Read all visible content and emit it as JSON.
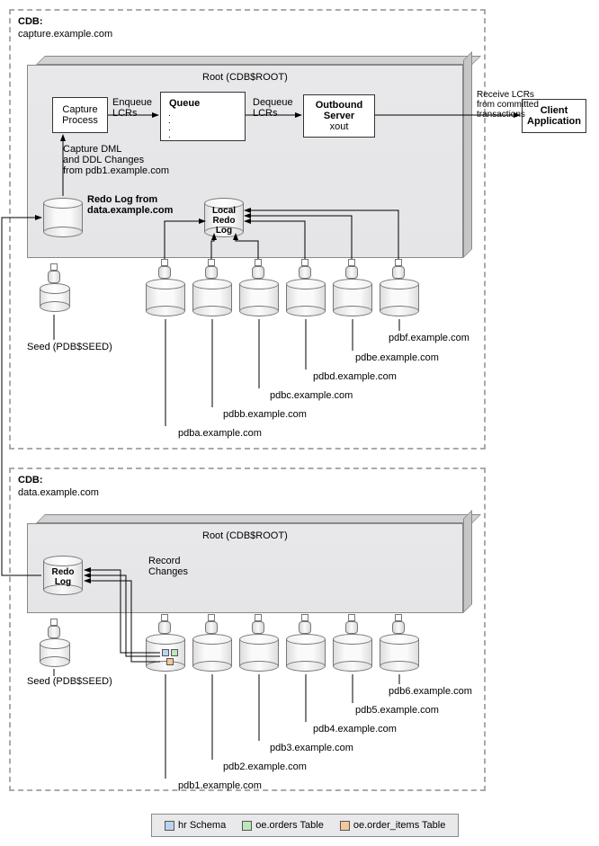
{
  "cdb1": {
    "title": "CDB:",
    "host": "capture.example.com",
    "root_title": "Root (CDB$ROOT)",
    "capture_process": "Capture\nProcess",
    "enqueue": "Enqueue\nLCRs",
    "queue": "Queue",
    "dequeue": "Dequeue\nLCRs",
    "outbound_title": "Outbound\nServer",
    "outbound_name": "xout",
    "receive": "Receive LCRs\nfrom committed\ntransactions",
    "client": "Client\nApplication",
    "capture_note": "Capture DML\nand DDL Changes\nfrom pdb1.example.com",
    "redo_from_label": "Redo Log from\ndata.example.com",
    "local_redo": "Local\nRedo Log",
    "seed": "Seed (PDB$SEED)",
    "pdbs": [
      "pdba.example.com",
      "pdbb.example.com",
      "pdbc.example.com",
      "pdbd.example.com",
      "pdbe.example.com",
      "pdbf.example.com"
    ]
  },
  "cdb2": {
    "title": "CDB:",
    "host": "data.example.com",
    "root_title": "Root (CDB$ROOT)",
    "redo": "Redo\nLog",
    "record": "Record\nChanges",
    "seed": "Seed (PDB$SEED)",
    "pdbs": [
      "pdb1.example.com",
      "pdb2.example.com",
      "pdb3.example.com",
      "pdb4.example.com",
      "pdb5.example.com",
      "pdb6.example.com"
    ]
  },
  "legend": {
    "hr": "hr Schema",
    "orders": "oe.orders Table",
    "order_items": "oe.order_items Table"
  }
}
